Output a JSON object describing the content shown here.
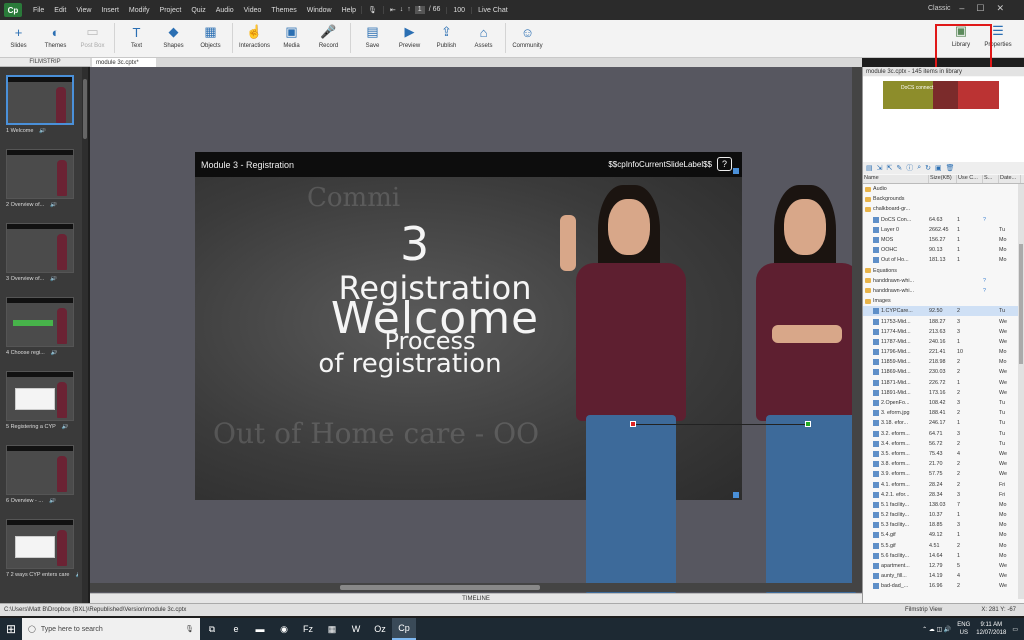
{
  "titlebar": {
    "logo": "Cp",
    "menus": [
      "File",
      "Edit",
      "View",
      "Insert",
      "Modify",
      "Project",
      "Quiz",
      "Audio",
      "Video",
      "Themes",
      "Window",
      "Help"
    ],
    "slide_num": "1",
    "slide_total": "/ 66",
    "zoom": "100",
    "live_chat": "Live Chat",
    "mode": "Classic"
  },
  "toolbar": {
    "tools": [
      {
        "label": "Slides",
        "icon": "+"
      },
      {
        "label": "Themes",
        "icon": "◐"
      },
      {
        "label": "Post Box",
        "icon": "▭"
      },
      {
        "label": "Text",
        "icon": "T"
      },
      {
        "label": "Shapes",
        "icon": "◆"
      },
      {
        "label": "Objects",
        "icon": "▦"
      },
      {
        "label": "Interactions",
        "icon": "☝"
      },
      {
        "label": "Media",
        "icon": "▣"
      },
      {
        "label": "Record",
        "icon": "🎤"
      },
      {
        "label": "Save",
        "icon": "▤"
      },
      {
        "label": "Preview",
        "icon": "▶"
      },
      {
        "label": "Publish",
        "icon": "⇪"
      },
      {
        "label": "Assets",
        "icon": "⌂"
      },
      {
        "label": "Community",
        "icon": "☺"
      }
    ],
    "library": "Library",
    "properties": "Properties"
  },
  "filmstrip": {
    "title": "FILMSTRIP",
    "slides": [
      {
        "label": "1 Welcome"
      },
      {
        "label": "2 Overview of..."
      },
      {
        "label": "3 Overview of..."
      },
      {
        "label": "4 Choose regi..."
      },
      {
        "label": "5 Registering a CYP"
      },
      {
        "label": "6 Overview - ..."
      },
      {
        "label": "7 2 ways CYP enters care"
      }
    ]
  },
  "document": {
    "tab": "module 3c.cptx*"
  },
  "slide": {
    "title": "Module 3 - Registration",
    "variable": "$$cpInfoCurrentSlideLabel$$",
    "help": "?",
    "number": "3",
    "line1": "Registration",
    "line2": "Welcome",
    "line3": "Process",
    "line4": "of registration",
    "faint_top": "Commi",
    "faint_bottom": "Out of Home care - OO"
  },
  "library": {
    "header": "module 3c.cptx - 145 items in library",
    "preview_title": "DoCS connect",
    "columns": [
      "Name",
      "Size(KB)",
      "Use C...",
      "S...",
      "Date..."
    ],
    "rows": [
      {
        "name": "Audio",
        "size": "",
        "use": "",
        "s": "",
        "d": "",
        "type": "folder"
      },
      {
        "name": "Backgrounds",
        "size": "",
        "use": "",
        "s": "",
        "d": "",
        "type": "folder"
      },
      {
        "name": "chalkboard-gr...",
        "size": "",
        "use": "",
        "s": "",
        "d": "",
        "type": "folder"
      },
      {
        "name": "DoCS Con...",
        "size": "64.63",
        "use": "1",
        "s": "?",
        "d": "",
        "type": "file"
      },
      {
        "name": "Layer 0",
        "size": "2662.45",
        "use": "1",
        "s": "",
        "d": "Tu",
        "type": "file"
      },
      {
        "name": "MOS",
        "size": "156.27",
        "use": "1",
        "s": "",
        "d": "Mo",
        "type": "file"
      },
      {
        "name": "OOHC",
        "size": "90.13",
        "use": "1",
        "s": "",
        "d": "Mo",
        "type": "file"
      },
      {
        "name": "Out of Ho...",
        "size": "181.13",
        "use": "1",
        "s": "",
        "d": "Mo",
        "type": "file"
      },
      {
        "name": "Equations",
        "size": "",
        "use": "",
        "s": "",
        "d": "",
        "type": "folder"
      },
      {
        "name": "handdrawn-whi...",
        "size": "",
        "use": "",
        "s": "?",
        "d": "",
        "type": "folder"
      },
      {
        "name": "handdrawn-whi...",
        "size": "",
        "use": "",
        "s": "?",
        "d": "",
        "type": "folder"
      },
      {
        "name": "Images",
        "size": "",
        "use": "",
        "s": "",
        "d": "",
        "type": "folder"
      },
      {
        "name": "1.CYPCare...",
        "size": "92.50",
        "use": "2",
        "s": "",
        "d": "Tu",
        "type": "file",
        "selected": true
      },
      {
        "name": "11753-Mid...",
        "size": "188.27",
        "use": "3",
        "s": "",
        "d": "We",
        "type": "file"
      },
      {
        "name": "11774-Mid...",
        "size": "213.63",
        "use": "3",
        "s": "",
        "d": "We",
        "type": "file"
      },
      {
        "name": "11787-Mid...",
        "size": "240.16",
        "use": "1",
        "s": "",
        "d": "We",
        "type": "file"
      },
      {
        "name": "11796-Mid...",
        "size": "221.41",
        "use": "10",
        "s": "",
        "d": "Mo",
        "type": "file"
      },
      {
        "name": "11859-Mid...",
        "size": "218.98",
        "use": "2",
        "s": "",
        "d": "Mo",
        "type": "file"
      },
      {
        "name": "11869-Mid...",
        "size": "230.03",
        "use": "2",
        "s": "",
        "d": "We",
        "type": "file"
      },
      {
        "name": "11871-Mid...",
        "size": "226.72",
        "use": "1",
        "s": "",
        "d": "We",
        "type": "file"
      },
      {
        "name": "11891-Mid...",
        "size": "173.16",
        "use": "2",
        "s": "",
        "d": "We",
        "type": "file"
      },
      {
        "name": "2.OpenFo...",
        "size": "108.42",
        "use": "3",
        "s": "",
        "d": "Tu",
        "type": "file"
      },
      {
        "name": "3. eform.jpg",
        "size": "188.41",
        "use": "2",
        "s": "",
        "d": "Tu",
        "type": "file"
      },
      {
        "name": "3.18. efor...",
        "size": "246.17",
        "use": "1",
        "s": "",
        "d": "Tu",
        "type": "file"
      },
      {
        "name": "3.2. eform...",
        "size": "64.71",
        "use": "3",
        "s": "",
        "d": "Tu",
        "type": "file"
      },
      {
        "name": "3.4. eform...",
        "size": "56.72",
        "use": "2",
        "s": "",
        "d": "Tu",
        "type": "file"
      },
      {
        "name": "3.5. eform...",
        "size": "75.43",
        "use": "4",
        "s": "",
        "d": "We",
        "type": "file"
      },
      {
        "name": "3.8. eform...",
        "size": "21.70",
        "use": "2",
        "s": "",
        "d": "We",
        "type": "file"
      },
      {
        "name": "3.9. eform...",
        "size": "57.75",
        "use": "2",
        "s": "",
        "d": "We",
        "type": "file"
      },
      {
        "name": "4.1. eform...",
        "size": "28.24",
        "use": "2",
        "s": "",
        "d": "Fri",
        "type": "file"
      },
      {
        "name": "4.2.1. efor...",
        "size": "28.34",
        "use": "3",
        "s": "",
        "d": "Fri",
        "type": "file"
      },
      {
        "name": "5.1 facility...",
        "size": "138.03",
        "use": "7",
        "s": "",
        "d": "Mo",
        "type": "file"
      },
      {
        "name": "5.2 facility...",
        "size": "10.37",
        "use": "1",
        "s": "",
        "d": "Mo",
        "type": "file"
      },
      {
        "name": "5.3 facility...",
        "size": "18.85",
        "use": "3",
        "s": "",
        "d": "Mo",
        "type": "file"
      },
      {
        "name": "5.4.gif",
        "size": "49.12",
        "use": "1",
        "s": "",
        "d": "Mo",
        "type": "file"
      },
      {
        "name": "5.5.gif",
        "size": "4.51",
        "use": "2",
        "s": "",
        "d": "Mo",
        "type": "file"
      },
      {
        "name": "5.6 facility...",
        "size": "14.64",
        "use": "1",
        "s": "",
        "d": "Mo",
        "type": "file"
      },
      {
        "name": "apartment...",
        "size": "12.79",
        "use": "5",
        "s": "",
        "d": "We",
        "type": "file"
      },
      {
        "name": "aunty_fill...",
        "size": "14.19",
        "use": "4",
        "s": "",
        "d": "We",
        "type": "file"
      },
      {
        "name": "bad-dad_...",
        "size": "16.96",
        "use": "2",
        "s": "",
        "d": "We",
        "type": "file"
      }
    ]
  },
  "timeline": {
    "label": "TIMELINE"
  },
  "status": {
    "path": "C:\\Users\\Matt B\\Dropbox (BXL)\\Republished\\Version\\module 3c.cptx",
    "view": "Filmstrip View",
    "coords": "X: 281 Y: -67"
  },
  "taskbar": {
    "search_placeholder": "Type here to search",
    "apps": [
      "⧉",
      "e",
      "▬",
      "◉",
      "Fz",
      "▦",
      "W",
      "Oz",
      "Cp"
    ],
    "lang": "ENG",
    "region": "US",
    "time": "9:11 AM",
    "date": "12/07/2018"
  },
  "colors": {
    "accent": "#4a90d9",
    "shirt": "#5e1f30",
    "highlight": "#e01818"
  }
}
